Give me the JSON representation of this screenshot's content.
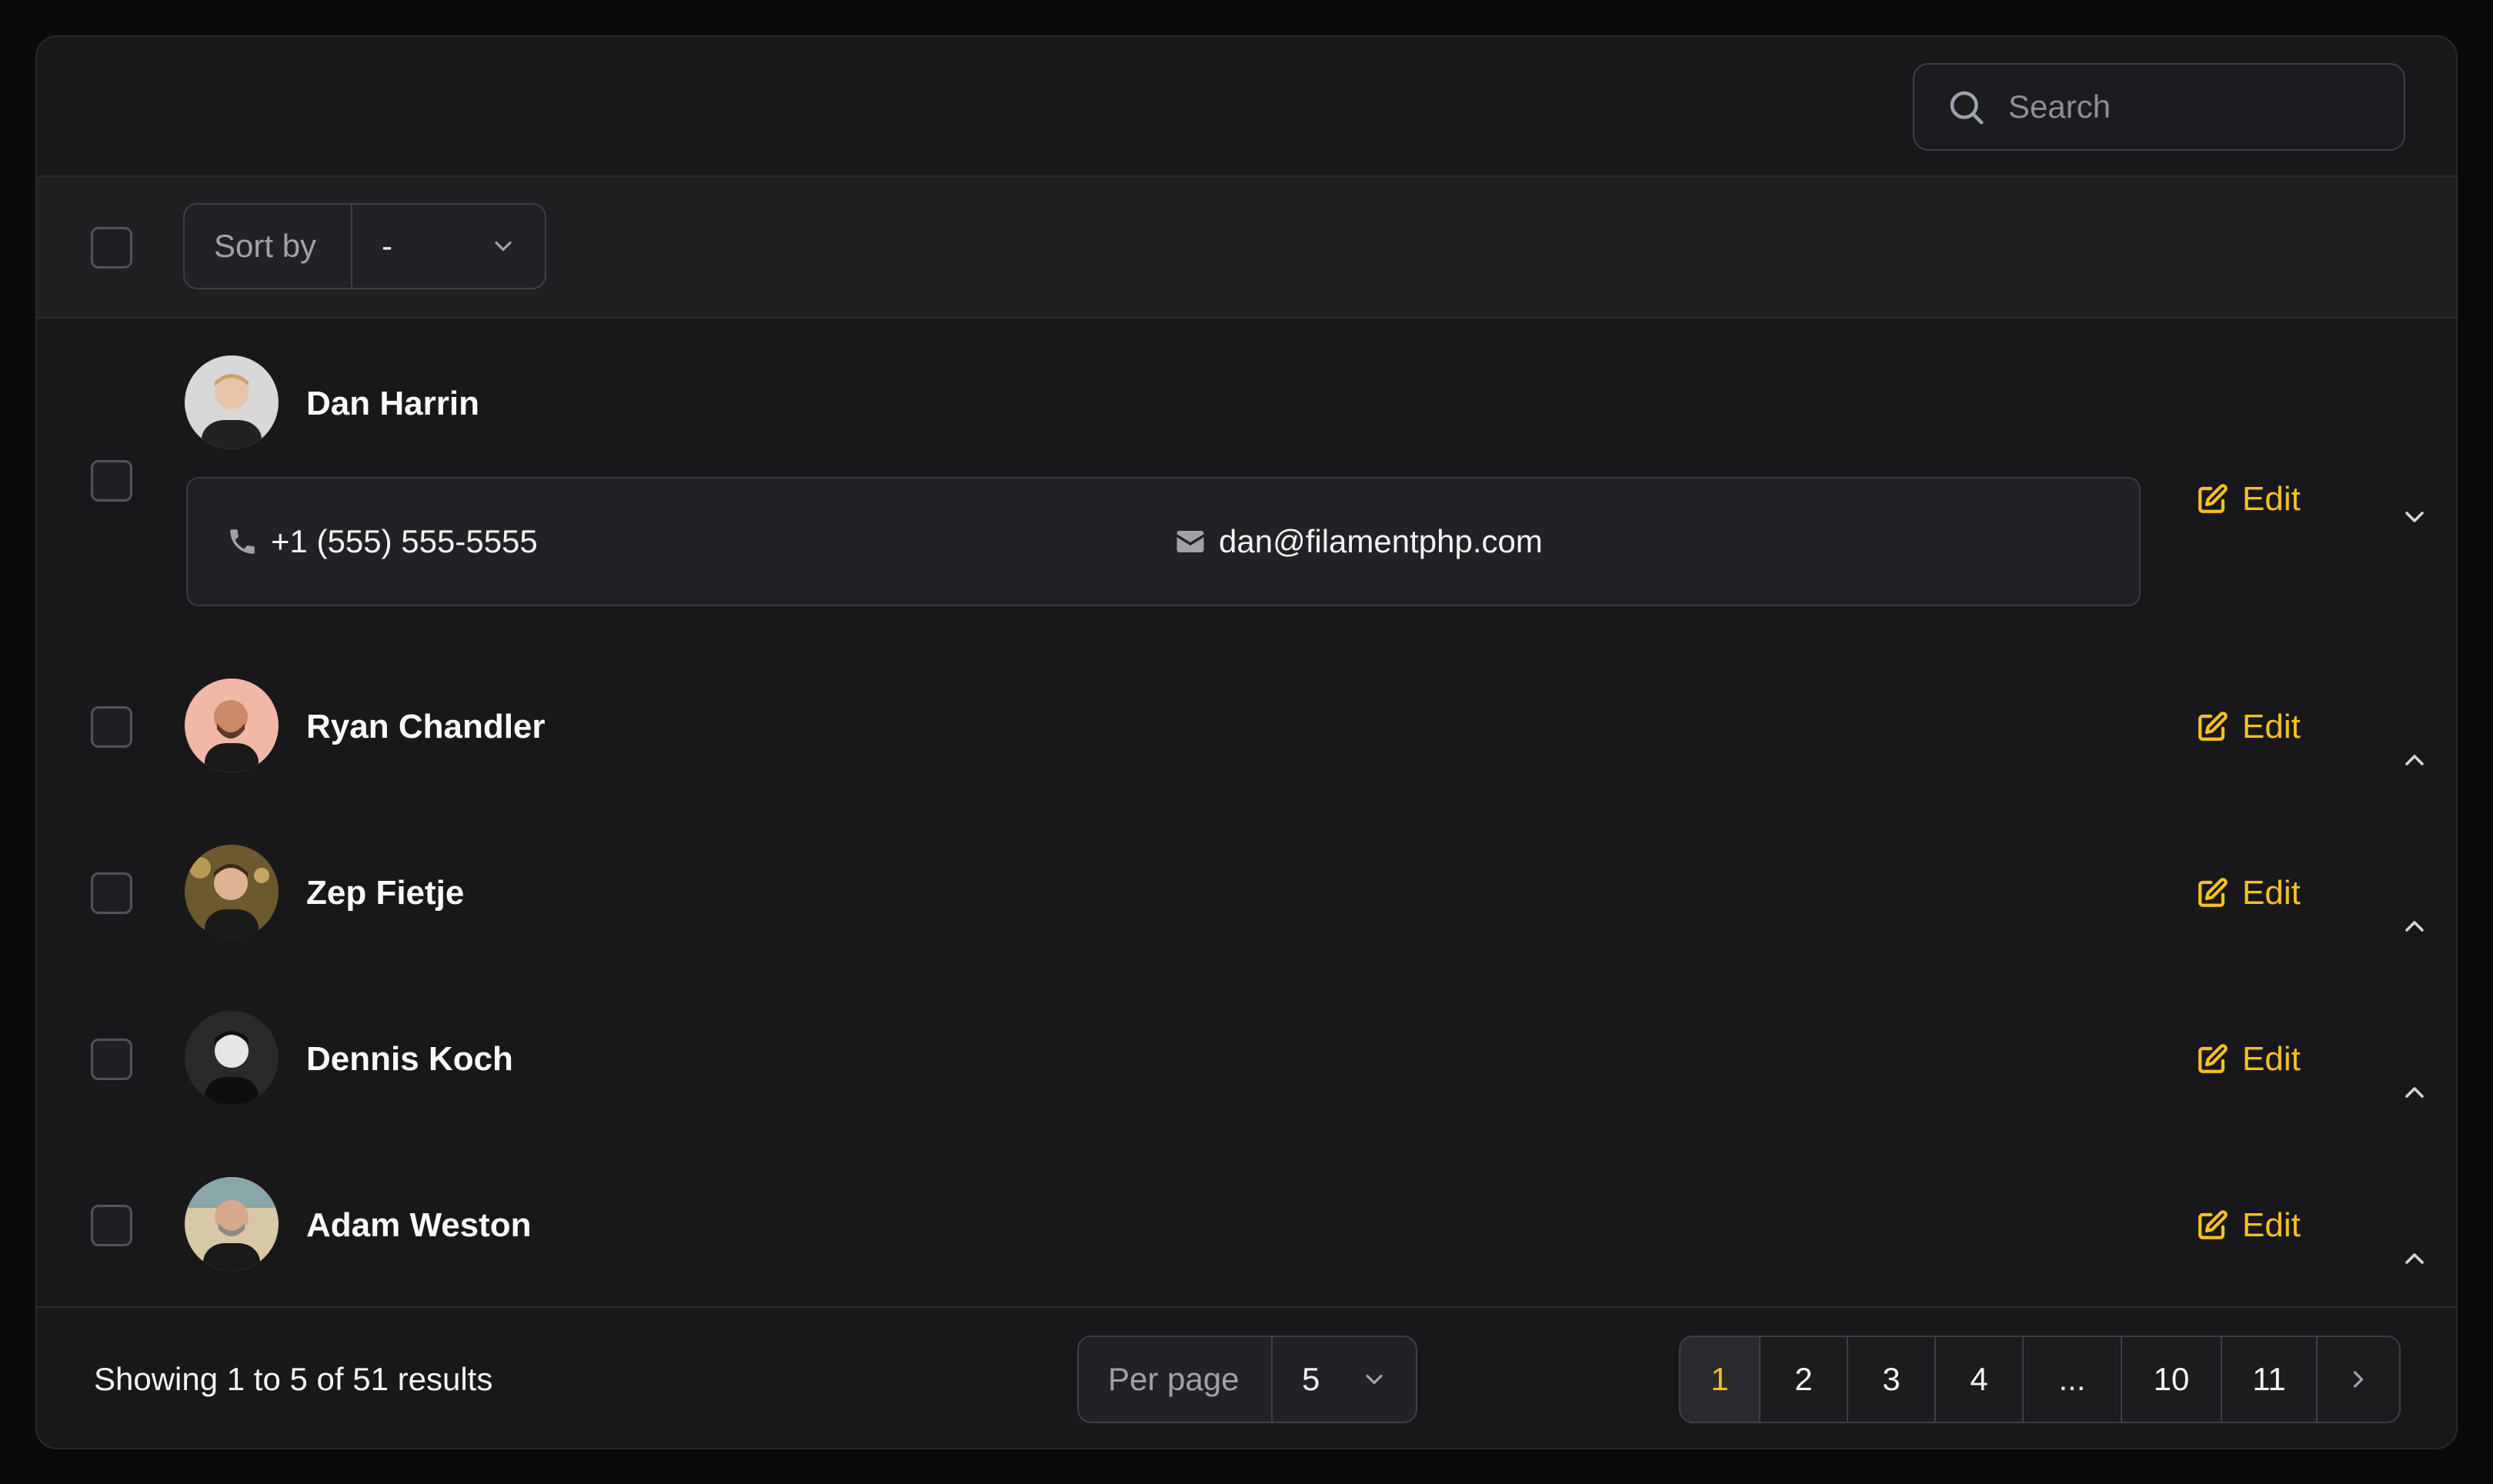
{
  "search": {
    "placeholder": "Search"
  },
  "toolbar": {
    "sort_label": "Sort by",
    "sort_value": "-"
  },
  "records": [
    {
      "name": "Dan Harrin",
      "phone": "+1 (555) 555-5555",
      "email": "dan@filamentphp.com",
      "expanded": true,
      "edit_label": "Edit"
    },
    {
      "name": "Ryan Chandler",
      "expanded": false,
      "edit_label": "Edit"
    },
    {
      "name": "Zep Fietje",
      "expanded": false,
      "edit_label": "Edit"
    },
    {
      "name": "Dennis Koch",
      "expanded": false,
      "edit_label": "Edit"
    },
    {
      "name": "Adam Weston",
      "expanded": false,
      "edit_label": "Edit"
    }
  ],
  "footer": {
    "showing": "Showing 1 to 5 of 51 results",
    "per_page_label": "Per page",
    "per_page_value": "5",
    "pages": [
      "1",
      "2",
      "3",
      "4",
      "...",
      "10",
      "11"
    ],
    "active_page": "1"
  },
  "colors": {
    "accent": "#fbbf24",
    "background": "#0a0a0c",
    "panel": "#18181b"
  }
}
